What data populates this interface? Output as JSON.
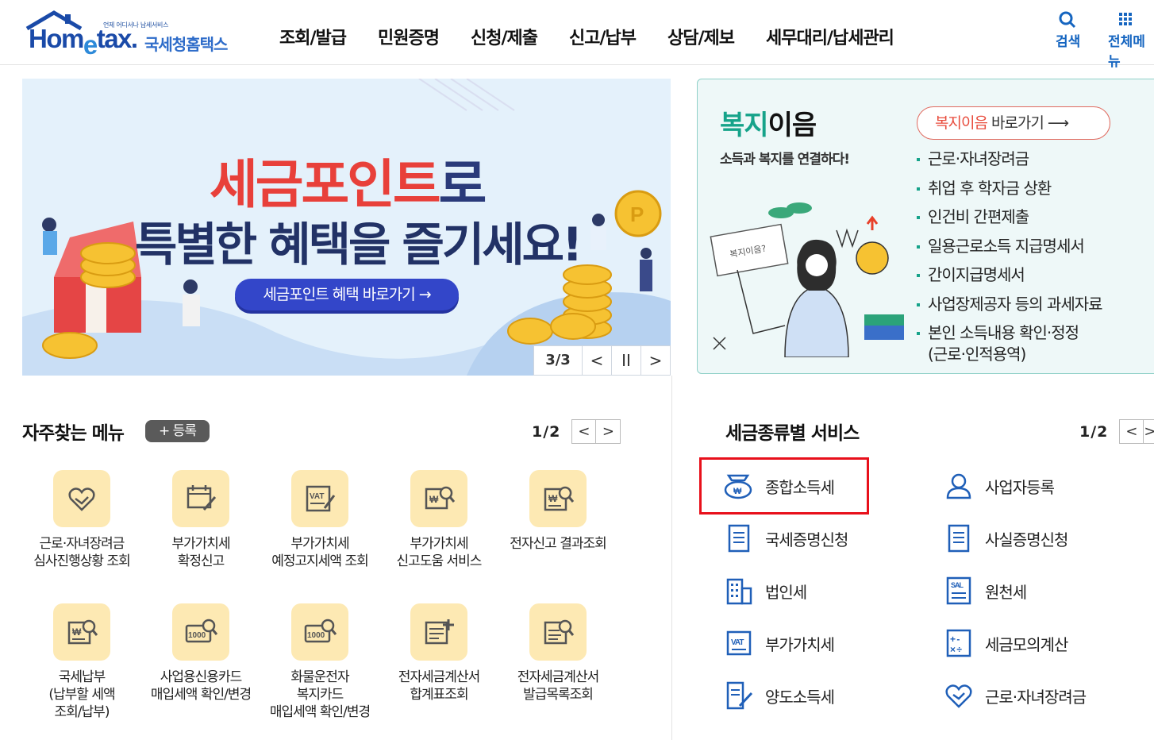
{
  "header": {
    "logo_tiny": "언제 어디서나 납세서비스",
    "logo_word_pre": "Hom",
    "logo_word_e": "e",
    "logo_word_post": "tax.",
    "logo_kr": "국세청홈택스",
    "nav": [
      "조회/발급",
      "민원증명",
      "신청/제출",
      "신고/납부",
      "상담/제보",
      "세무대리/납세관리"
    ],
    "search_label": "검색",
    "all_menu_label": "전체메뉴"
  },
  "banner": {
    "title_red": "세금포인트",
    "title_ro": "로",
    "title_line2": "특별한 혜택을 즐기세요!",
    "cta_label": "세금포인트 혜택 바로가기 →",
    "page": "3/3",
    "prev": "<",
    "pause": "II",
    "next": ">"
  },
  "welfare": {
    "title_green": "복지",
    "title_black": "이음",
    "subtitle": "소득과 복지를 연결하다!",
    "go_red": "복지이음",
    "go_black": " 바로가기 ⟶",
    "items": [
      "근로·자녀장려금",
      "취업 후 학자금 상환",
      "인건비 간편제출",
      "일용근로소득 지급명세서",
      "간이지급명세서",
      "사업장제공자 등의 과세자료",
      "본인 소득내용 확인·정정\n(근로·인적용역)"
    ]
  },
  "freq": {
    "title": "자주찾는 메뉴",
    "register": "+ 등록",
    "page": "1/2",
    "prev": "<",
    "next": ">",
    "items": [
      {
        "label": "근로·자녀장려금\n심사진행상황 조회",
        "icon": "heart-hand-icon"
      },
      {
        "label": "부가가치세\n확정신고",
        "icon": "calendar-pen-icon"
      },
      {
        "label": "부가가치세\n예정고지세액 조회",
        "icon": "vat-pen-icon"
      },
      {
        "label": "부가가치세\n신고도움 서비스",
        "icon": "won-search-icon"
      },
      {
        "label": "전자신고 결과조회",
        "icon": "won-doc-search-icon"
      },
      {
        "label": "국세납부\n(납부할 세액\n조회/납부)",
        "icon": "won-doc-search-icon"
      },
      {
        "label": "사업용신용카드\n매입세액 확인/변경",
        "icon": "card-search-icon"
      },
      {
        "label": "화물운전자\n복지카드\n매입세액 확인/변경",
        "icon": "card-search-icon"
      },
      {
        "label": "전자세금계산서\n합계표조회",
        "icon": "invoice-plus-icon"
      },
      {
        "label": "전자세금계산서\n발급목록조회",
        "icon": "invoice-search-icon"
      }
    ]
  },
  "tax": {
    "title": "세금종류별 서비스",
    "page": "1/2",
    "prev": "<",
    "next": ">",
    "items": [
      {
        "label": "종합소득세",
        "icon": "money-bag-icon"
      },
      {
        "label": "사업자등록",
        "icon": "person-icon"
      },
      {
        "label": "국세증명신청",
        "icon": "document-icon"
      },
      {
        "label": "사실증명신청",
        "icon": "document-icon"
      },
      {
        "label": "법인세",
        "icon": "building-icon"
      },
      {
        "label": "원천세",
        "icon": "salary-doc-icon"
      },
      {
        "label": "부가가치세",
        "icon": "vat-doc-icon"
      },
      {
        "label": "세금모의계산",
        "icon": "calculator-icon"
      },
      {
        "label": "양도소득세",
        "icon": "doc-pen-icon"
      },
      {
        "label": "근로·자녀장려금",
        "icon": "heart-icon"
      }
    ]
  },
  "colors": {
    "brand_blue": "#1a4aa8",
    "accent_red": "#e8403a",
    "welfare_green": "#16a38a",
    "highlight": "#e8101b"
  }
}
